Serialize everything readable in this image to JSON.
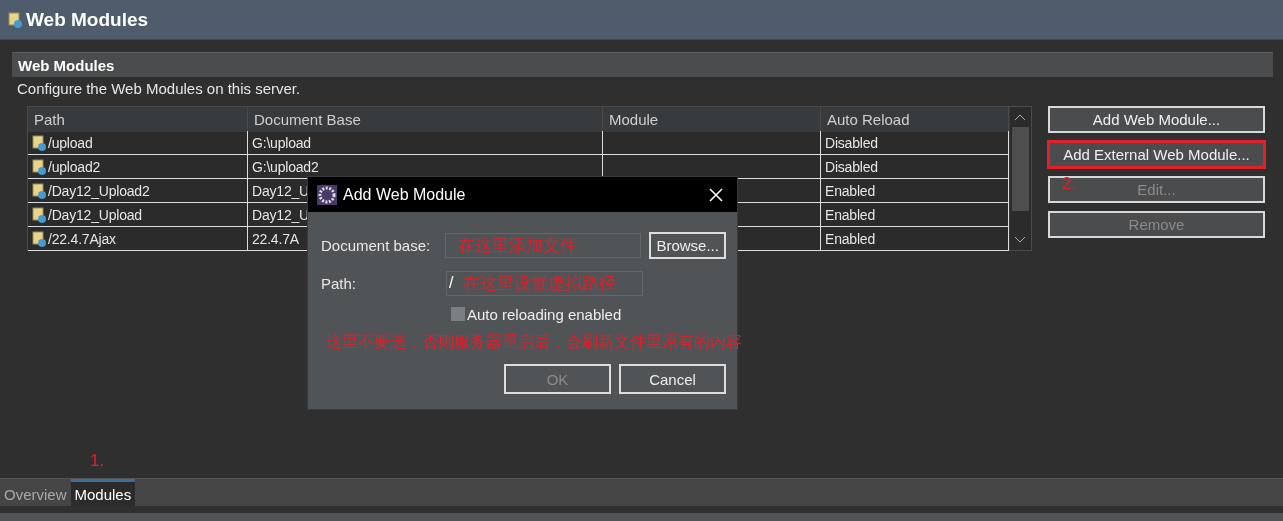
{
  "editor": {
    "title": "Web Modules"
  },
  "section": {
    "title": "Web Modules",
    "description": "Configure the Web Modules on this server."
  },
  "table": {
    "columns": [
      "Path",
      "Document Base",
      "Module",
      "Auto Reload"
    ],
    "rows": [
      {
        "path": "/upload",
        "document_base": "G:\\upload",
        "auto_reload": "Disabled"
      },
      {
        "path": "/upload2",
        "document_base": "G:\\upload2",
        "auto_reload": "Disabled"
      },
      {
        "path": "/Day12_Upload2",
        "document_base": "Day12_U",
        "auto_reload": "Enabled"
      },
      {
        "path": "/Day12_Upload",
        "document_base": "Day12_U",
        "auto_reload": "Enabled"
      },
      {
        "path": "/22.4.7Ajax",
        "document_base": "22.4.7A",
        "auto_reload": "Enabled"
      }
    ]
  },
  "buttons": [
    {
      "label": "Add Web Module...",
      "disabled": false,
      "highlighted": false
    },
    {
      "label": "Add External Web Module...",
      "disabled": false,
      "highlighted": true
    },
    {
      "label": "Edit...",
      "disabled": true,
      "highlighted": false
    },
    {
      "label": "Remove",
      "disabled": true,
      "highlighted": false
    }
  ],
  "button_annotation": "2.",
  "dialog": {
    "title": "Add Web Module",
    "fields": [
      {
        "label": "Document base:",
        "annotation": "在这里添加文件"
      },
      {
        "label": "Path:",
        "value": "/",
        "annotation": "在这里设置虚拟路径"
      }
    ],
    "browse_button": "Browse...",
    "checkbox": {
      "label": "Auto reloading enabled",
      "checked": false
    },
    "note": "这里不要选，否则服务器重启后，会刷新文件里原有的内容",
    "buttons": [
      {
        "label": "OK",
        "disabled": true
      },
      {
        "label": "Cancel",
        "disabled": false
      }
    ]
  },
  "tab_annotation": "1.",
  "tabs": [
    {
      "label": "Overview",
      "selected": false
    },
    {
      "label": "Modules",
      "selected": true
    }
  ]
}
